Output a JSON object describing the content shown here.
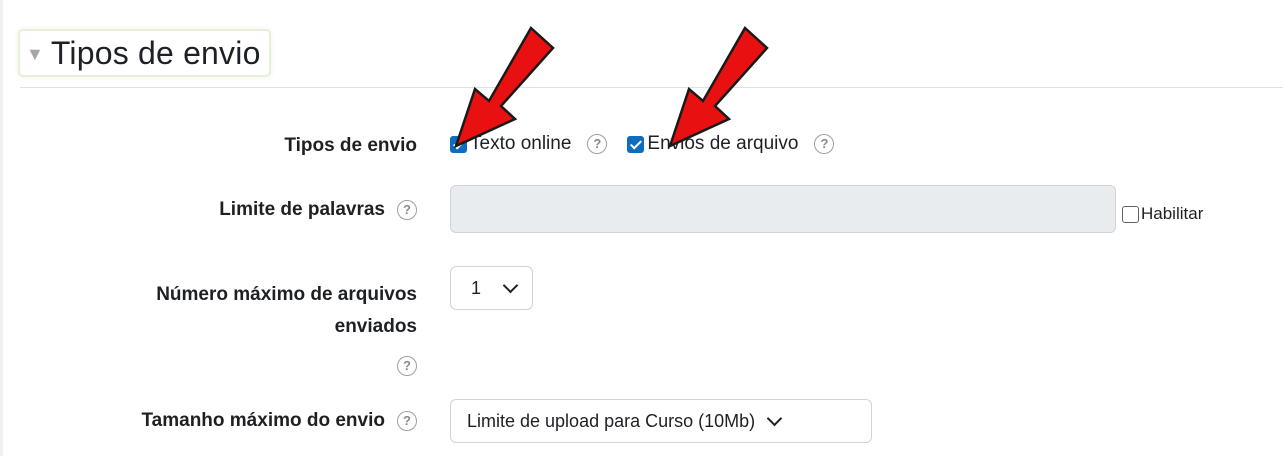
{
  "section": {
    "title": "Tipos de envio"
  },
  "submission_types": {
    "label": "Tipos de envio",
    "options": [
      {
        "label": "Texto online",
        "checked": true
      },
      {
        "label": "Envios de arquivo",
        "checked": true
      }
    ]
  },
  "word_limit": {
    "label": "Limite de palavras",
    "value": "",
    "enable_label": "Habilitar",
    "enabled": false
  },
  "max_files": {
    "label_line1": "Número máximo de arquivos",
    "label_line2": "enviados",
    "selected": "1"
  },
  "max_size": {
    "label": "Tamanho máximo do envio",
    "selected": "Limite de upload para Curso (10Mb)"
  },
  "colors": {
    "accent": "#0f6cbf",
    "annotation_arrow": "#e81010"
  },
  "icons": {
    "help": "question-circle-icon",
    "collapse": "caret-down-icon",
    "dropdown": "chevron-down-icon",
    "annotation": "red-arrow-icon"
  }
}
